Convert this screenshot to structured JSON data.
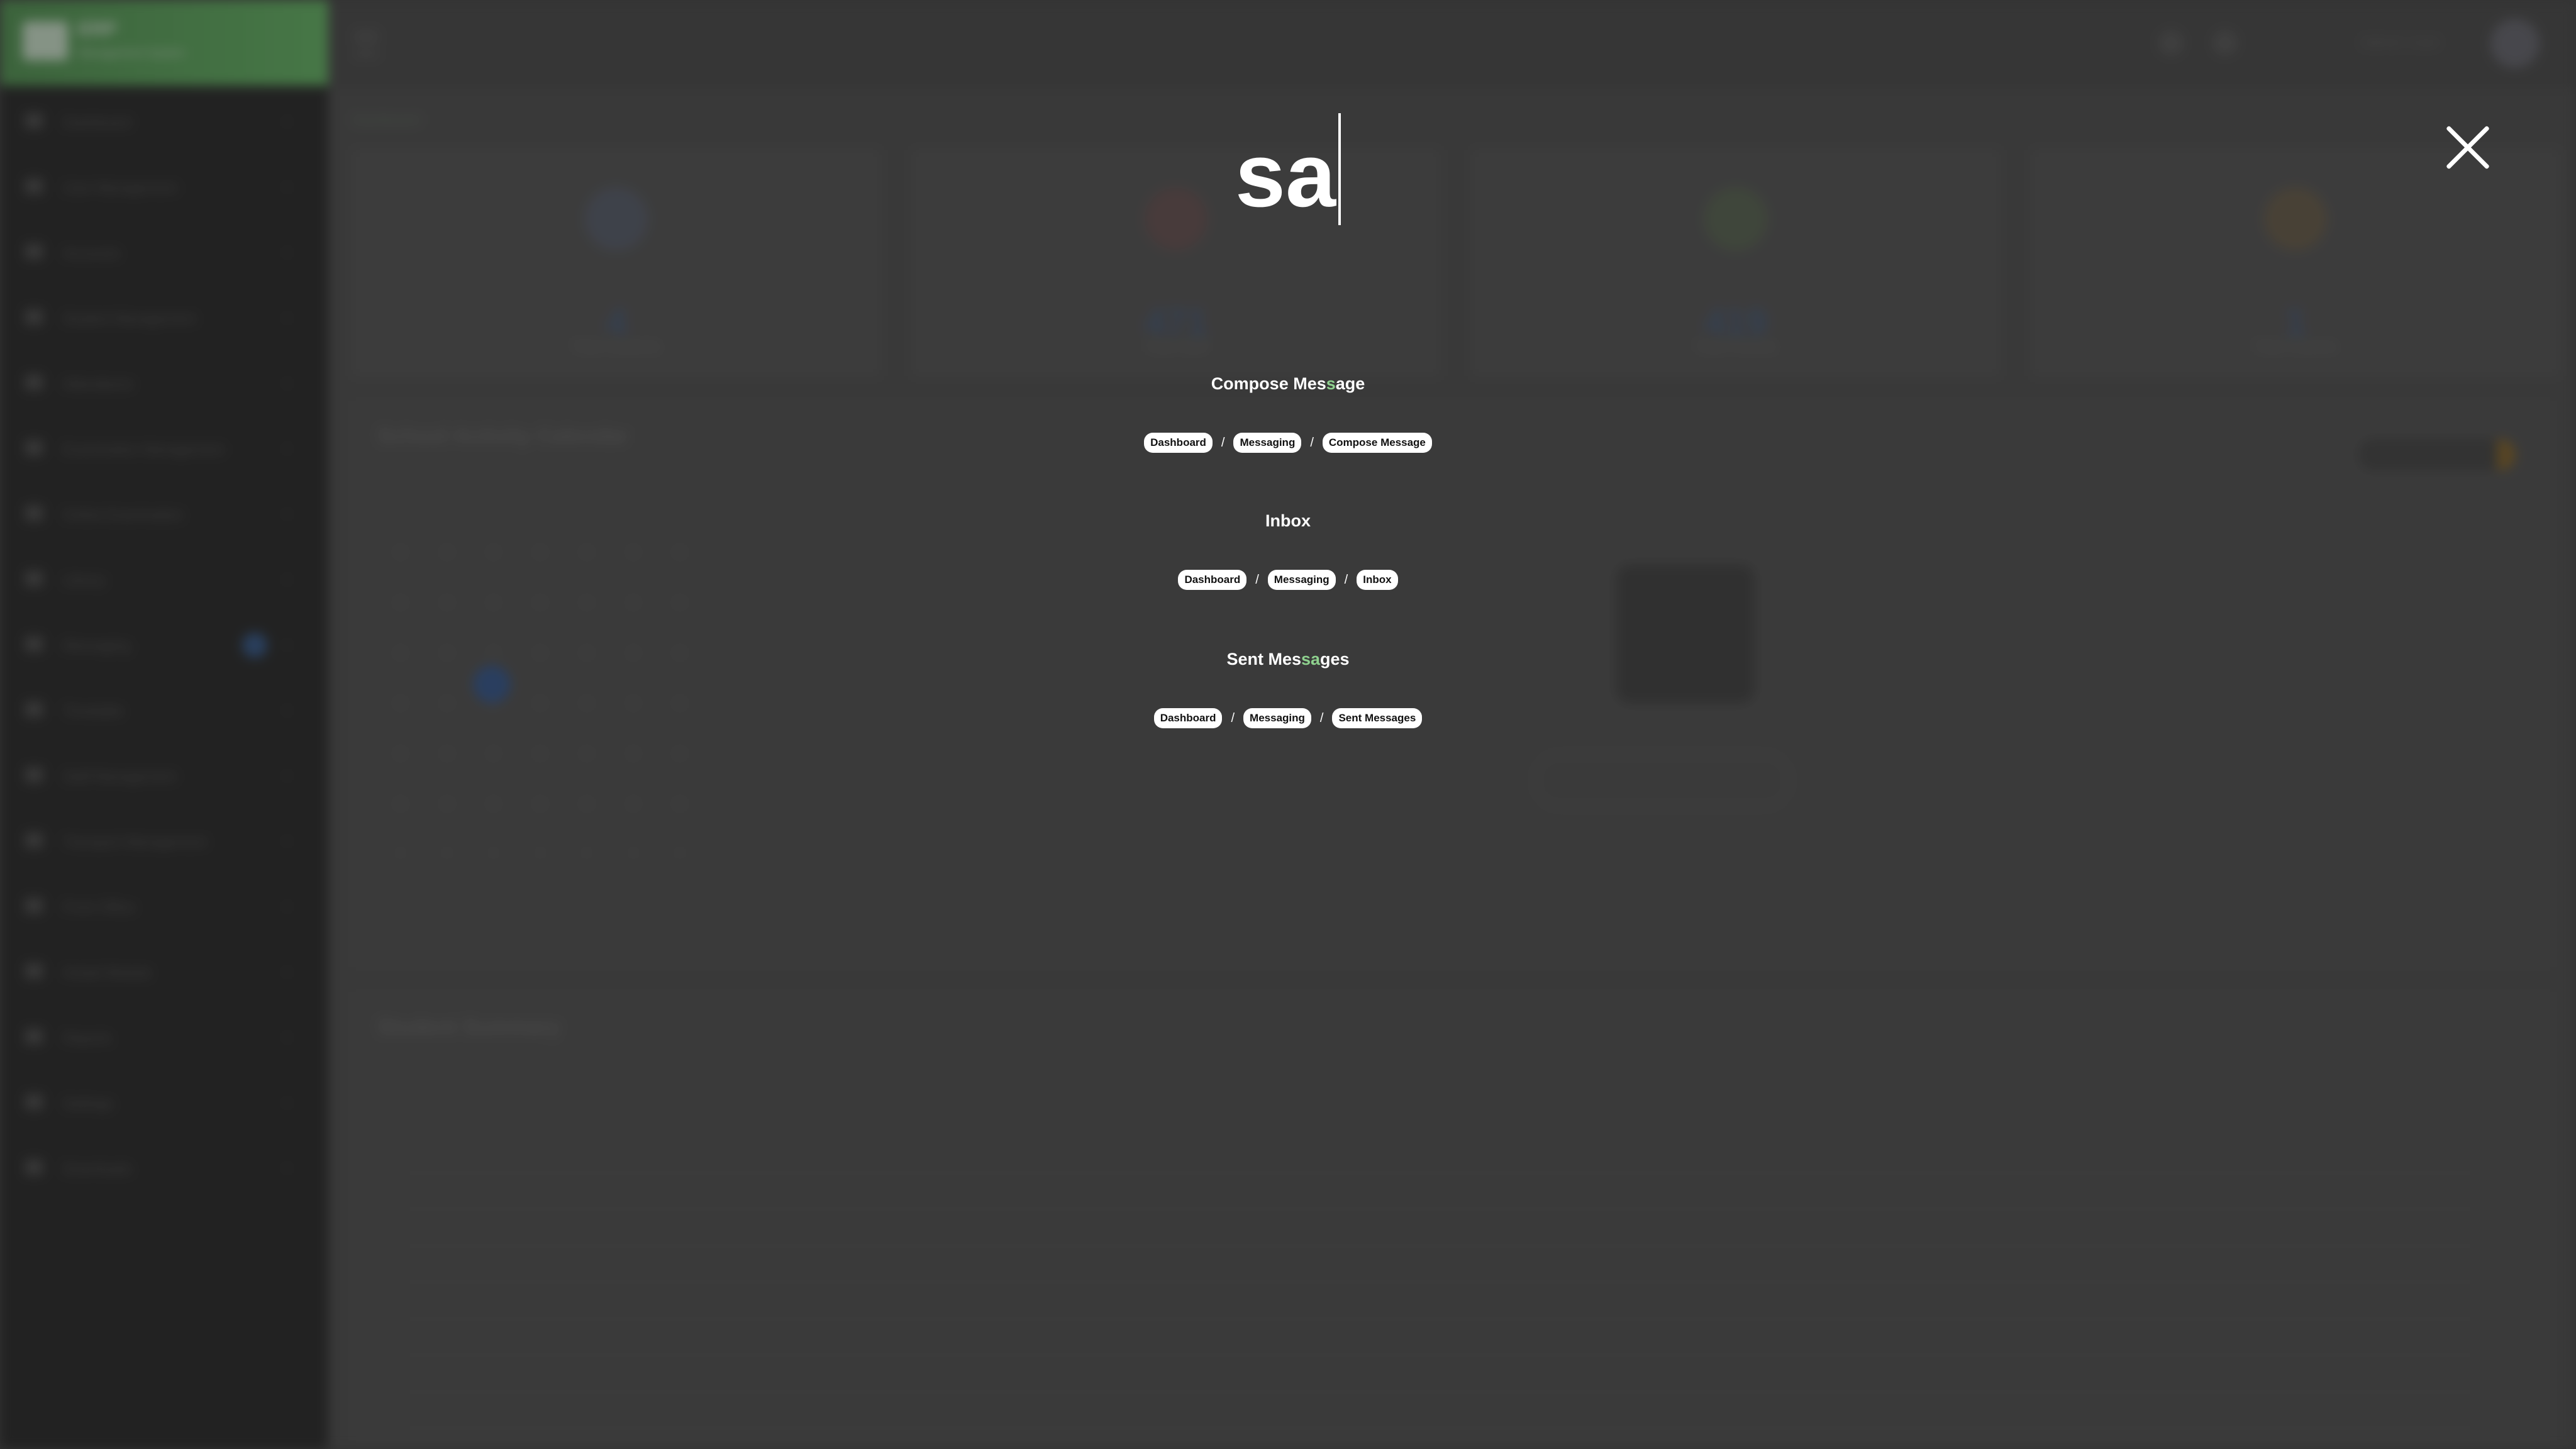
{
  "brand": {
    "title": "ERP",
    "subtitle": "Management System"
  },
  "sidebar": {
    "items": [
      {
        "label": "Dashboard"
      },
      {
        "label": "User Management"
      },
      {
        "label": "Accounts"
      },
      {
        "label": "Student Management"
      },
      {
        "label": "Attendance"
      },
      {
        "label": "Examination Management"
      },
      {
        "label": "Online Examination"
      },
      {
        "label": "Library"
      },
      {
        "label": "Messaging"
      },
      {
        "label": "Timetable"
      },
      {
        "label": "Staff Management"
      },
      {
        "label": "Transport Management"
      },
      {
        "label": "Front Office"
      },
      {
        "label": "Hostel Module"
      },
      {
        "label": "Reports"
      },
      {
        "label": "Settings"
      },
      {
        "label": "Downloads"
      }
    ]
  },
  "topbar": {
    "user_name": "Admin User"
  },
  "breadcrumb": {
    "label": "Dashboard"
  },
  "stats": [
    {
      "value": "4",
      "label": "Total Students"
    },
    {
      "value": "471",
      "label": "Total Staff"
    },
    {
      "value": "419",
      "label": "Total Parents"
    },
    {
      "value": "1",
      "label": "Total Classes"
    }
  ],
  "panels": {
    "calendar_title": "School Activity Calendar",
    "summary_title": "Student Summary"
  },
  "search": {
    "query": "sa",
    "results": [
      {
        "title_parts": [
          "Compose Mes",
          "s",
          "age"
        ],
        "crumbs": [
          "Dashboard",
          "Messaging",
          "Compose Message"
        ]
      },
      {
        "title_parts": [
          "Inbox",
          "",
          ""
        ],
        "crumbs": [
          "Dashboard",
          "Messaging",
          "Inbox"
        ]
      },
      {
        "title_parts": [
          "Sent Mes",
          "sa",
          "ges"
        ],
        "crumbs": [
          "Dashboard",
          "Messaging",
          "Sent Messages"
        ]
      }
    ],
    "separator": "/"
  },
  "colors": {
    "highlight": "#8ed18e",
    "overlay": "#141414",
    "chip_bg": "#ffffff"
  }
}
